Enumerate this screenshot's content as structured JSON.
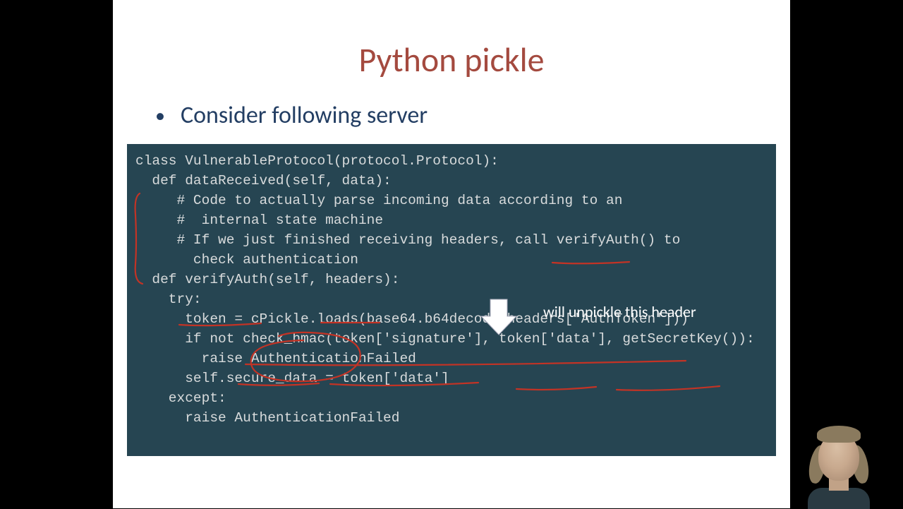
{
  "title": "Python pickle",
  "bullet": "Consider following server",
  "annotation": "will unpickle  this header",
  "code": {
    "l1": "class VulnerableProtocol(protocol.Protocol):",
    "l2": "  def dataReceived(self, data):",
    "l3": "",
    "l4": "     # Code to actually parse incoming data according to an",
    "l5": "     #  internal state machine",
    "l6": "     # If we just finished receiving headers, call verifyAuth() to",
    "l7": "       check authentication",
    "l8": "",
    "l9": "  def verifyAuth(self, headers):",
    "l10": "    try:",
    "l11": "      token = cPickle.loads(base64.b64decode(headers['AuthToken']))",
    "l12": "      if not check_hmac(token['signature'], token['data'], getSecretKey()):",
    "l13": "        raise AuthenticationFailed",
    "l14": "      self.secure_data = token['data']",
    "l15": "    except:",
    "l16": "      raise AuthenticationFailed"
  }
}
